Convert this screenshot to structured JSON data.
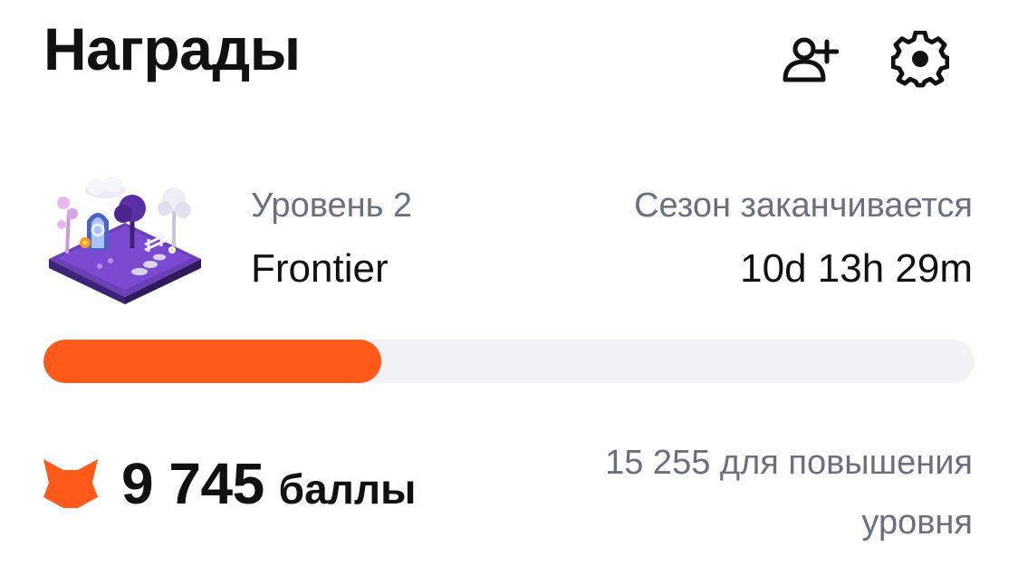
{
  "header": {
    "title": "Награды",
    "add_friend_icon": "person-plus-icon",
    "settings_icon": "gear-icon"
  },
  "level": {
    "label": "Уровень 2",
    "name": "Frontier",
    "art": "fantasy-island-illustration"
  },
  "season": {
    "label": "Сезон заканчивается",
    "time_left": "10d 13h 29m"
  },
  "progress": {
    "fraction": 0.363,
    "fill_color": "#ff5a1a",
    "track_color": "#f1f2f6"
  },
  "points": {
    "value": "9 745",
    "unit": "баллы",
    "icon": "fox-icon",
    "icon_color": "#ff5a1a"
  },
  "next_level": {
    "text": "15 255 для повышения уровня"
  }
}
